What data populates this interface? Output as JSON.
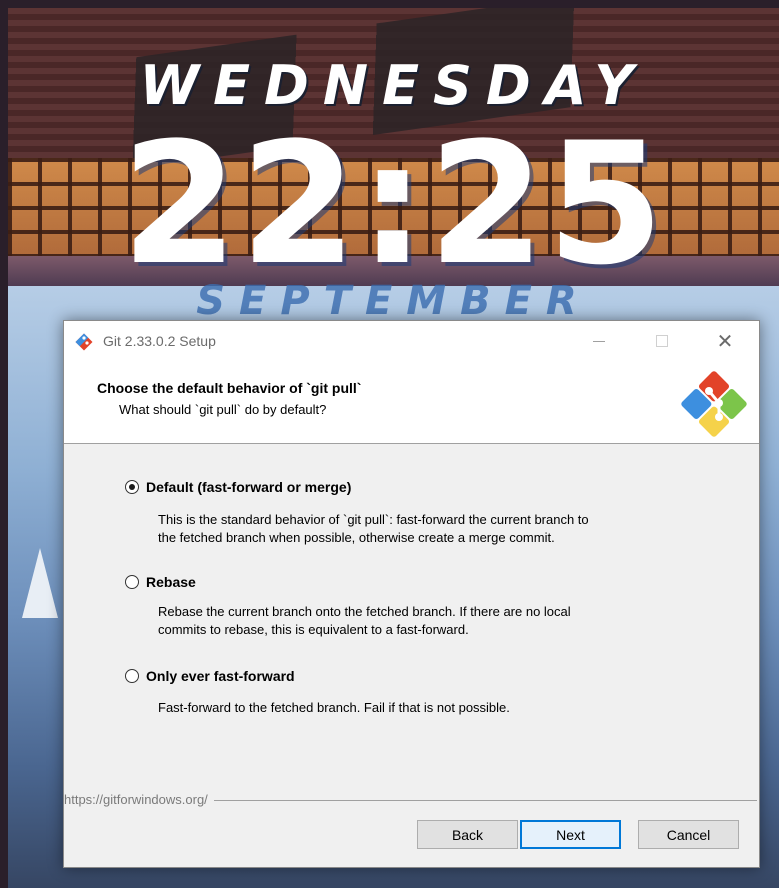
{
  "wallpaper": {
    "weekday": "WEDNESDAY",
    "time": "22:25",
    "month": "SEPTEMBER"
  },
  "dialog": {
    "title": "Git 2.33.0.2 Setup",
    "header": {
      "title": "Choose the default behavior of `git pull`",
      "subtitle": "What should `git pull` do by default?"
    },
    "options": [
      {
        "label": "Default (fast-forward or merge)",
        "desc_lines": [
          "This is the standard behavior of `git pull`: fast-forward the current branch to",
          "the fetched branch when possible, otherwise create a merge commit."
        ],
        "checked": true
      },
      {
        "label": "Rebase",
        "desc_lines": [
          "Rebase the current branch onto the fetched branch. If there are no local",
          "commits to rebase, this is equivalent to a fast-forward."
        ],
        "checked": false
      },
      {
        "label": "Only ever fast-forward",
        "desc_lines": [
          "Fast-forward to the fetched branch. Fail if that is not possible."
        ],
        "checked": false
      }
    ],
    "footer_link": "https://gitforwindows.org/",
    "buttons": {
      "back": "Back",
      "next": "Next",
      "cancel": "Cancel"
    },
    "icons": {
      "titlebar": "git-icon",
      "header": "git-logo-icon",
      "minimize": "minimize-icon",
      "maximize": "maximize-icon",
      "close": "close-icon"
    },
    "colors": {
      "accent": "#0078d7",
      "git_red": "#e24329",
      "git_blue": "#3d8fdf",
      "git_green": "#7cc54a",
      "git_yellow": "#f5d24a"
    }
  }
}
